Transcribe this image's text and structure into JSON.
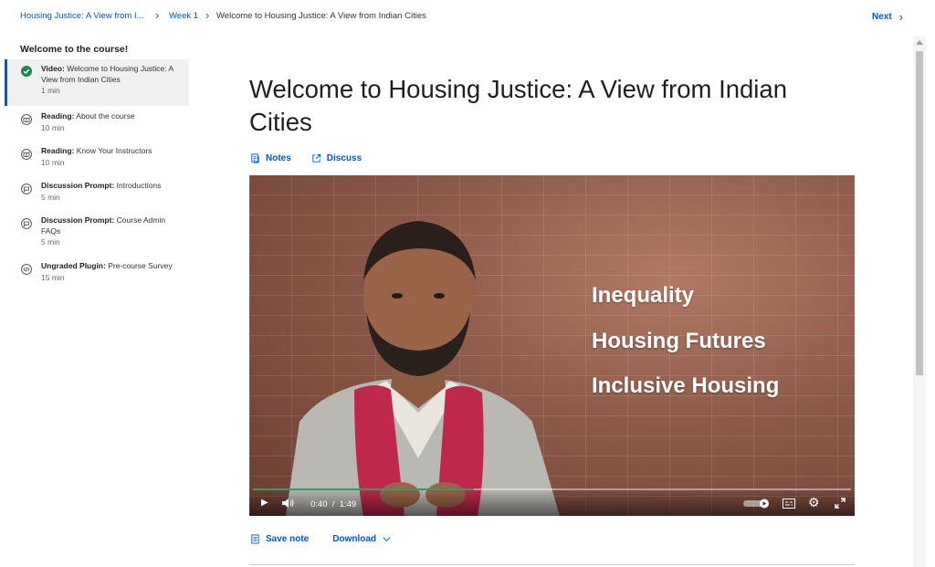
{
  "breadcrumb": {
    "course": "Housing Justice: A View from I...",
    "week": "Week 1",
    "current": "Welcome to Housing Justice: A View from Indian Cities"
  },
  "next_label": "Next",
  "sidebar": {
    "section_title": "Welcome to the course!",
    "items": [
      {
        "type": "Video:",
        "name": "Welcome to Housing Justice: A View from Indian Cities",
        "duration": "1 min",
        "icon": "check-complete-icon",
        "active": true
      },
      {
        "type": "Reading:",
        "name": "About the course",
        "duration": "10 min",
        "icon": "reading-icon"
      },
      {
        "type": "Reading:",
        "name": "Know Your Instructors",
        "duration": "10 min",
        "icon": "reading-icon"
      },
      {
        "type": "Discussion Prompt:",
        "name": "Introductions",
        "duration": "5 min",
        "icon": "discussion-icon"
      },
      {
        "type": "Discussion Prompt:",
        "name": "Course Admin FAQs",
        "duration": "5 min",
        "icon": "discussion-icon"
      },
      {
        "type": "Ungraded Plugin:",
        "name": "Pre-course Survey",
        "duration": "15 min",
        "icon": "plugin-icon"
      }
    ]
  },
  "main": {
    "title": "Welcome to Housing Justice: A View from Indian Cities",
    "notes_label": "Notes",
    "discuss_label": "Discuss",
    "save_note_label": "Save note",
    "download_label": "Download"
  },
  "video": {
    "overlay_lines": [
      "Inequality",
      "Housing Futures",
      "Inclusive Housing"
    ],
    "current_time": "0:40",
    "duration": "1:49",
    "time_separator": "/",
    "progress": 0.37,
    "accent_color": "#2e9e62"
  },
  "colors": {
    "link": "#0056d2",
    "active_border": "#0056d2",
    "complete": "#1f8354"
  }
}
